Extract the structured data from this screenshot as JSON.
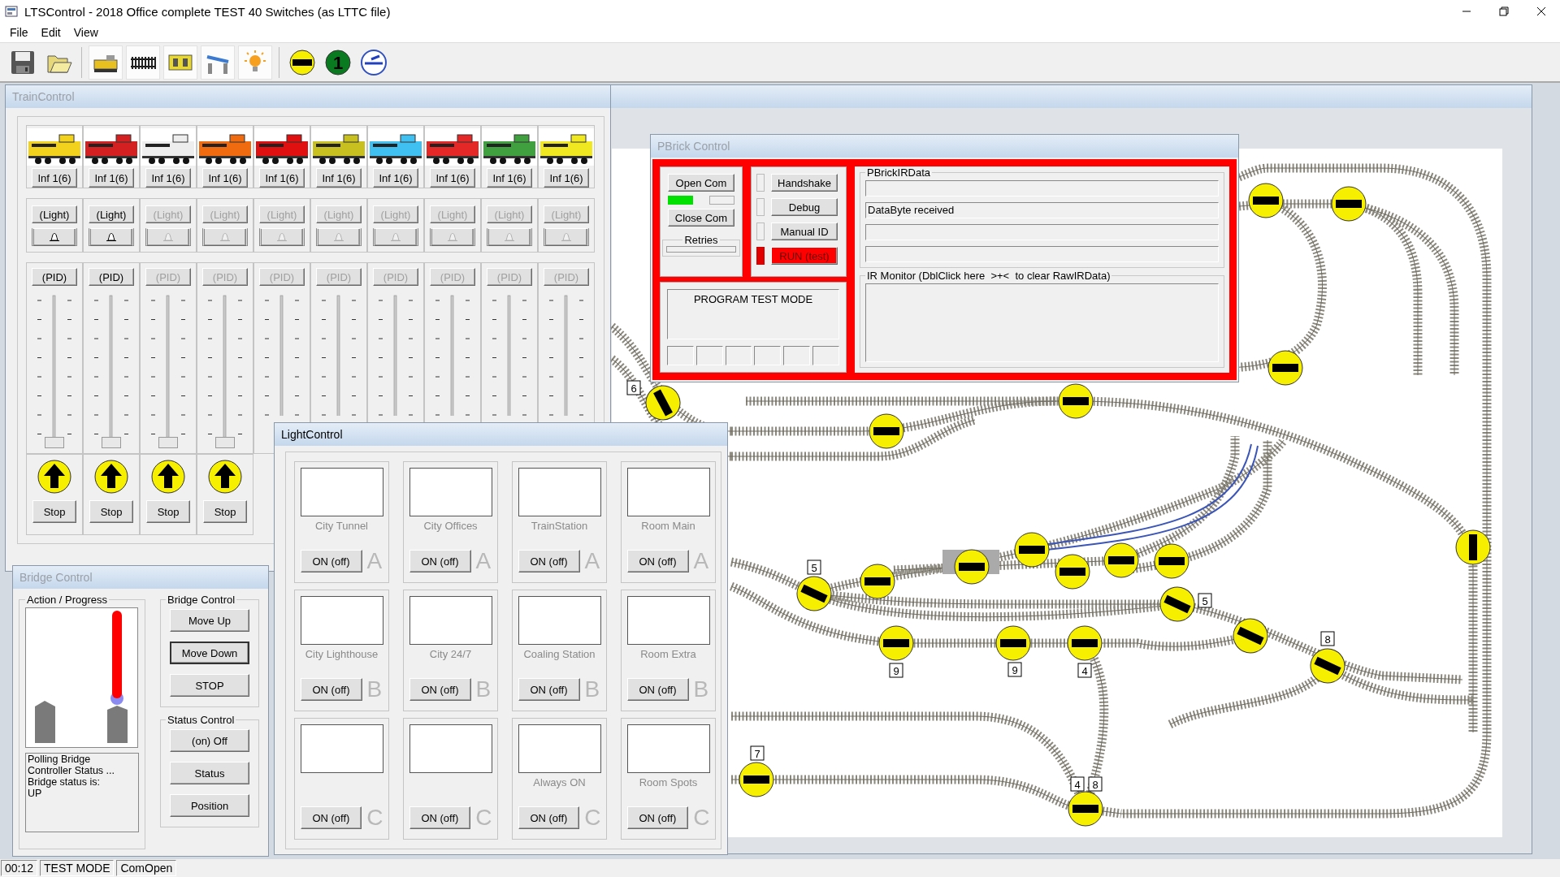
{
  "app": {
    "title": "LTSControl - 2018 Office complete TEST 40 Switches (as LTTC file)"
  },
  "menu": [
    {
      "label": "File"
    },
    {
      "label": "Edit"
    },
    {
      "label": "View"
    }
  ],
  "toolbar": [
    {
      "kind": "save"
    },
    {
      "kind": "open"
    },
    {
      "kind": "train"
    },
    {
      "kind": "track"
    },
    {
      "kind": "brick"
    },
    {
      "kind": "bridge"
    },
    {
      "kind": "light"
    },
    {
      "kind": "switch"
    },
    {
      "kind": "signal",
      "label": "1"
    },
    {
      "kind": "turntable"
    }
  ],
  "train_control": {
    "title": "TrainControl",
    "active": false,
    "trains": [
      {
        "color": "#f2d21c",
        "mode": "Inf 1(6)",
        "light": "(Light)",
        "pid": "(PID)",
        "enabled": true,
        "level": 0,
        "stop": "Stop"
      },
      {
        "color": "#d42020",
        "mode": "Inf 1(6)",
        "light": "(Light)",
        "pid": "(PID)",
        "enabled": true,
        "level": 0,
        "stop": "Stop"
      },
      {
        "color": "#eeeeee",
        "mode": "Inf 1(6)",
        "light": "(Light)",
        "pid": "(PID)",
        "enabled": false,
        "level": 0,
        "stop": "Stop"
      },
      {
        "color": "#f06a10",
        "mode": "Inf 1(6)",
        "light": "(Light)",
        "pid": "(PID)",
        "enabled": false,
        "level": 0,
        "stop": "Stop"
      },
      {
        "color": "#e01010",
        "mode": "Inf 1(6)",
        "light": "(Light)",
        "pid": "(PID)",
        "enabled": false
      },
      {
        "color": "#c8c020",
        "mode": "Inf 1(6)",
        "light": "(Light)",
        "pid": "(PID)",
        "enabled": false
      },
      {
        "color": "#40c0f0",
        "mode": "Inf 1(6)",
        "light": "(Light)",
        "pid": "(PID)",
        "enabled": false
      },
      {
        "color": "#e42828",
        "mode": "Inf 1(6)",
        "light": "(Light)",
        "pid": "(PID)",
        "enabled": false
      },
      {
        "color": "#40a040",
        "mode": "Inf 1(6)",
        "light": "(Light)",
        "pid": "(PID)",
        "enabled": false
      },
      {
        "color": "#f0e820",
        "mode": "Inf 1(6)",
        "light": "(Light)",
        "pid": "(PID)",
        "enabled": false
      }
    ]
  },
  "layout": {
    "block_labels": [
      {
        "text": "6"
      },
      {
        "text": "5"
      },
      {
        "text": "5"
      },
      {
        "text": "9"
      },
      {
        "text": "9"
      },
      {
        "text": "4"
      },
      {
        "text": "8"
      },
      {
        "text": "7"
      },
      {
        "text": "4"
      },
      {
        "text": "8"
      }
    ]
  },
  "pbrick": {
    "title": "PBrick Control",
    "active": false,
    "open_com": "Open Com",
    "com_indicators": [
      {
        "on": true
      },
      {
        "on": false
      }
    ],
    "close_com": "Close Com",
    "retries_label": "Retries",
    "toggles": [
      {
        "label": "Handshake",
        "on": false
      },
      {
        "label": "Debug",
        "on": false
      },
      {
        "label": "Manual ID",
        "on": false
      },
      {
        "label": "RUN (test)",
        "on": true
      }
    ],
    "mode_text": "PROGRAM TEST MODE",
    "ir_data_label": "PBrickIRData",
    "ir_data_fields": [
      {
        "kind": "empty"
      },
      {
        "kind": "text",
        "value": "DataByte received"
      },
      {
        "kind": "empty"
      },
      {
        "kind": "empty"
      }
    ],
    "ir_monitor_label": "IR Monitor (DblClick here  >+<  to clear RawIRData)"
  },
  "light_control": {
    "title": "LightControl",
    "active": true,
    "lights": [
      {
        "name": "City Tunnel",
        "button": "ON (off)",
        "group": "A"
      },
      {
        "name": "City Offices",
        "button": "ON (off)",
        "group": "A"
      },
      {
        "name": "TrainStation",
        "button": "ON (off)",
        "group": "A"
      },
      {
        "name": "Room Main",
        "button": "ON (off)",
        "group": "A"
      },
      {
        "name": "City Lighthouse",
        "button": "ON (off)",
        "group": "B"
      },
      {
        "name": "City 24/7",
        "button": "ON (off)",
        "group": "B"
      },
      {
        "name": "Coaling Station",
        "button": "ON (off)",
        "group": "B"
      },
      {
        "name": "Room Extra",
        "button": "ON (off)",
        "group": "B"
      },
      {
        "button": "ON (off)",
        "group": "C"
      },
      {
        "button": "ON (off)",
        "group": "C"
      },
      {
        "name": "Always ON",
        "button": "ON (off)",
        "group": "C"
      },
      {
        "name": "Room Spots",
        "button": "ON (off)",
        "group": "C"
      }
    ]
  },
  "bridge_control": {
    "title": "Bridge Control",
    "active": false,
    "progress_label": "Action / Progress",
    "log": "Polling Bridge\nController Status ...\nBridge status is:\nUP",
    "bridge_group_label": "Bridge Control",
    "bridge_buttons": [
      {
        "label": "Move Up",
        "focused": false
      },
      {
        "label": "Move Down",
        "focused": true
      },
      {
        "label": "STOP",
        "focused": false
      }
    ],
    "status_group_label": "Status Control",
    "status_buttons": [
      {
        "label": "(on) Off"
      },
      {
        "label": "Status"
      },
      {
        "label": "Position"
      }
    ]
  },
  "status_bar": [
    {
      "text": "00:12"
    },
    {
      "text": "TEST MODE"
    },
    {
      "text": "ComOpen"
    }
  ]
}
